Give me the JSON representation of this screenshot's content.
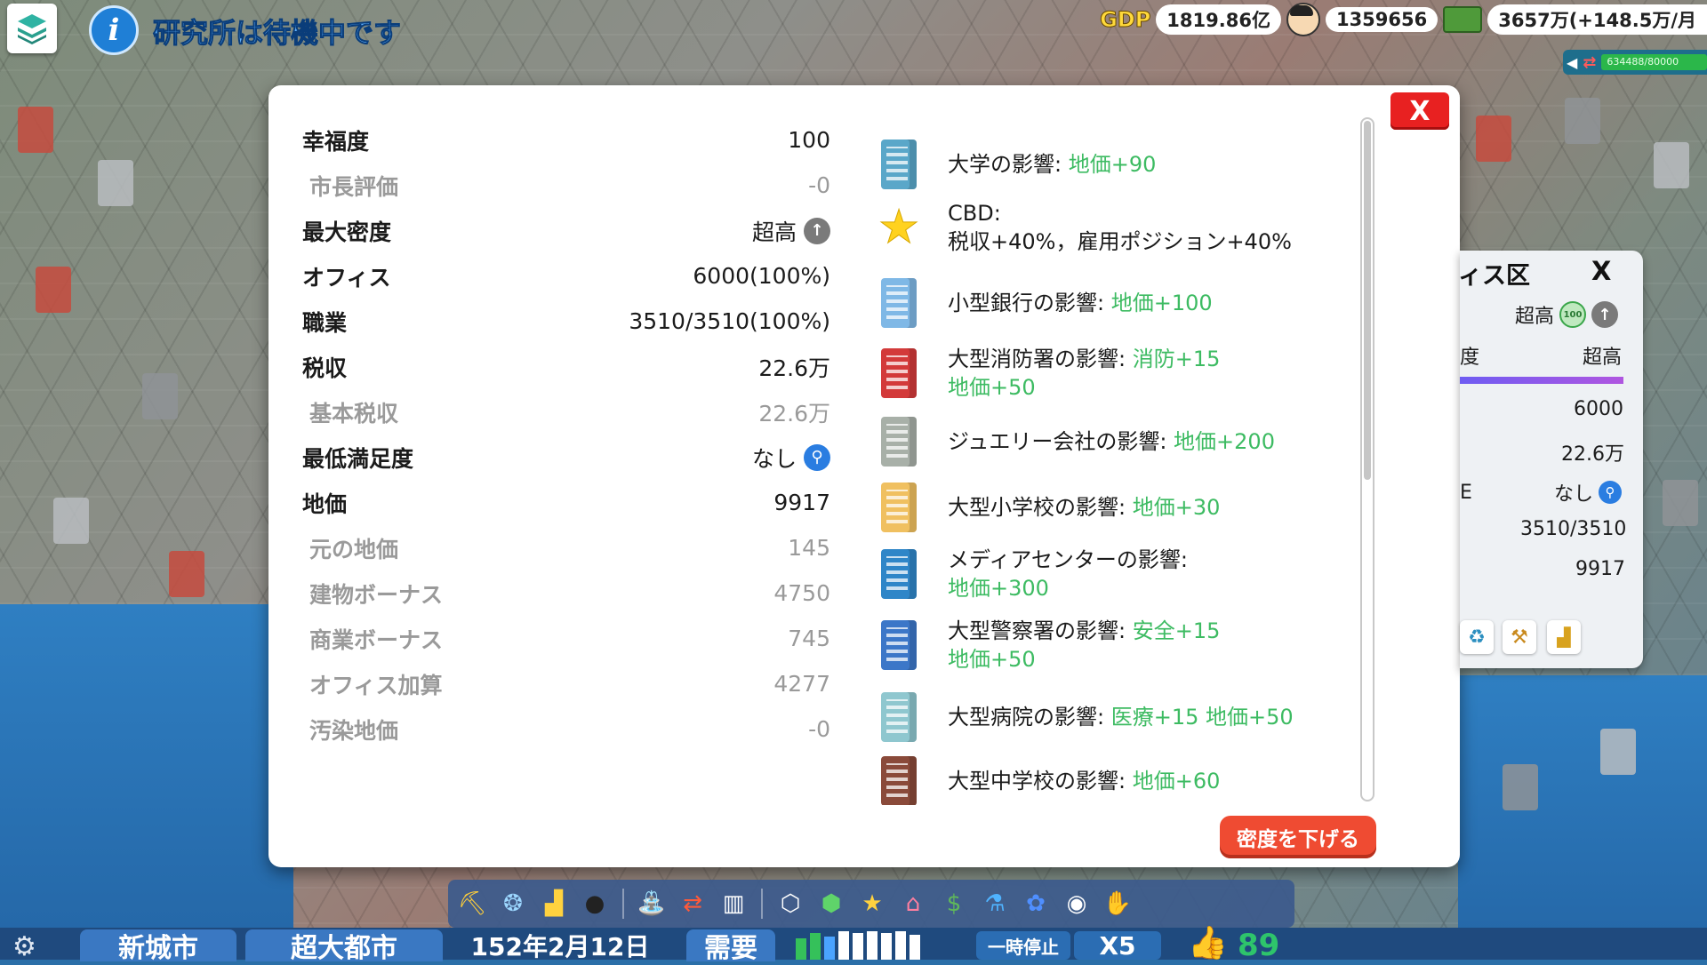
{
  "top": {
    "lab_status": "研究所は待機中です",
    "gdp_label": "GDP",
    "gdp_value": "1819.86亿",
    "population": "1359656",
    "money": "3657万(+148.5万/月",
    "pop_progress_text": "634488/80000"
  },
  "dialog": {
    "close_label": "X",
    "stats": [
      {
        "label": "幸福度",
        "value": "100",
        "sub": false
      },
      {
        "label": "市長評価",
        "value": "-0",
        "sub": true
      },
      {
        "label": "最大密度",
        "value": "超高",
        "sub": false,
        "icon": "arrow-up-icon"
      },
      {
        "label": "オフィス",
        "value": "6000(100%)",
        "sub": false
      },
      {
        "label": "職業",
        "value": "3510/3510(100%)",
        "sub": false
      },
      {
        "label": "税収",
        "value": "22.6万",
        "sub": false
      },
      {
        "label": "基本税収",
        "value": "22.6万",
        "sub": true
      },
      {
        "label": "最低満足度",
        "value": "なし",
        "sub": false,
        "icon": "magnifier-icon"
      },
      {
        "label": "地価",
        "value": "9917",
        "sub": false
      },
      {
        "label": "元の地価",
        "value": "145",
        "sub": true
      },
      {
        "label": "建物ボーナス",
        "value": "4750",
        "sub": true
      },
      {
        "label": "商業ボーナス",
        "value": "745",
        "sub": true
      },
      {
        "label": "オフィス加算",
        "value": "4277",
        "sub": true
      },
      {
        "label": "汚染地価",
        "value": "-0",
        "sub": true
      }
    ],
    "effects": [
      {
        "icon": "university-building-icon",
        "color": "#5aa7c9",
        "line1": "大学の影響: ",
        "line1_green": "地価+90",
        "line2": "",
        "line2_green": ""
      },
      {
        "icon": "star-icon",
        "color": "#ffd21f",
        "line1": "CBD:",
        "line1_green": "",
        "line2": "税収+40%，雇用ポジション+40%",
        "line2_green": ""
      },
      {
        "icon": "small-bank-building-icon",
        "color": "#7fb8e6",
        "line1": "小型銀行の影響: ",
        "line1_green": "地価+100",
        "line2": "",
        "line2_green": ""
      },
      {
        "icon": "fire-station-building-icon",
        "color": "#d33a3a",
        "line1": "大型消防署の影響: ",
        "line1_green": "消防+15",
        "line2": "",
        "line2_green": "地価+50"
      },
      {
        "icon": "jewelry-company-building-icon",
        "color": "#a8b0a8",
        "line1": "ジュエリー会社の影響: ",
        "line1_green": "地価+200",
        "line2": "",
        "line2_green": ""
      },
      {
        "icon": "elementary-school-building-icon",
        "color": "#f0c060",
        "line1": "大型小学校の影響: ",
        "line1_green": "地価+30",
        "line2": "",
        "line2_green": ""
      },
      {
        "icon": "media-center-building-icon",
        "color": "#2f86c8",
        "line1": "メディアセンターの影響:",
        "line1_green": "",
        "line2": "",
        "line2_green": "地価+300"
      },
      {
        "icon": "police-station-building-icon",
        "color": "#3c77c8",
        "line1": "大型警察署の影響: ",
        "line1_green": "安全+15",
        "line2": "",
        "line2_green": "地価+50"
      },
      {
        "icon": "hospital-building-icon",
        "color": "#8fc7cf",
        "line1": "大型病院の影響: ",
        "line1_green": "医療+15 地価+50",
        "line2": "",
        "line2_green": ""
      },
      {
        "icon": "middle-school-building-icon",
        "color": "#8a4a3a",
        "line1": "大型中学校の影響: ",
        "line1_green": "地価+60",
        "line2": "",
        "line2_green": ""
      }
    ],
    "lower_density_label": "密度を下げる"
  },
  "side_panel": {
    "title": "ィス区",
    "close_label": "X",
    "density": "超高",
    "badge": "100",
    "density2_label": "度",
    "density2": "超高",
    "office": "6000",
    "tax": "22.6万",
    "min_sat_label": "E",
    "min_sat": "なし",
    "jobs": "3510/3510",
    "land": "9917"
  },
  "bottom": {
    "city_name": "新城市",
    "city_rank": "超大都市",
    "date": "152年2月12日",
    "demand_label": "需要",
    "pause_label": "一時停止",
    "speed_label": "X5",
    "approval": "89"
  }
}
